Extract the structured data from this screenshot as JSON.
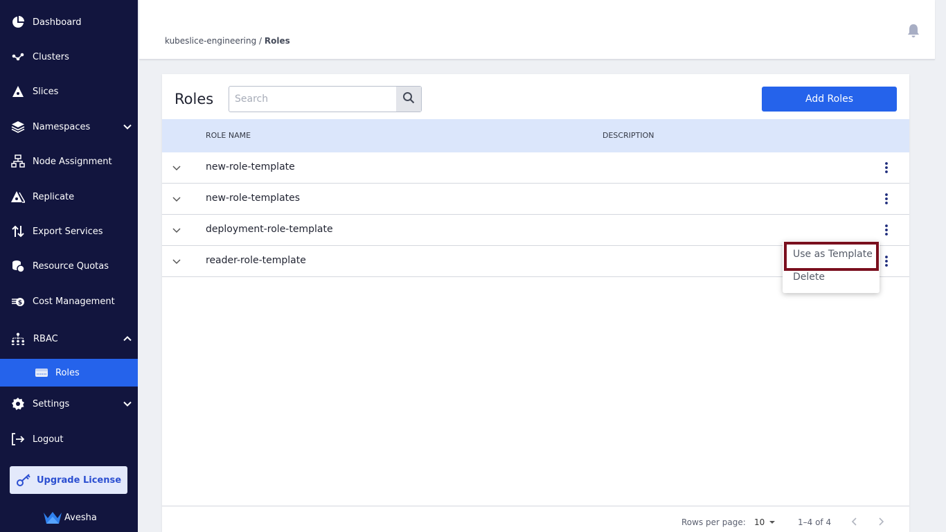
{
  "sidebar": {
    "items": [
      {
        "label": "Dashboard",
        "icon": "pie-chart-icon"
      },
      {
        "label": "Clusters",
        "icon": "network-icon"
      },
      {
        "label": "Slices",
        "icon": "slice-icon"
      },
      {
        "label": "Namespaces",
        "icon": "layers-icon"
      },
      {
        "label": "Node Assignment",
        "icon": "sitemap-icon"
      },
      {
        "label": "Replicate",
        "icon": "replicate-icon"
      },
      {
        "label": "Export Services",
        "icon": "arrows-updown-icon"
      },
      {
        "label": "Resource Quotas",
        "icon": "coins-icon"
      },
      {
        "label": "Cost Management",
        "icon": "cost-icon"
      },
      {
        "label": "RBAC",
        "icon": "rbac-icon"
      },
      {
        "label": "Roles",
        "icon": "roles-icon"
      },
      {
        "label": "Settings",
        "icon": "gear-icon"
      },
      {
        "label": "Logout",
        "icon": "logout-icon"
      }
    ],
    "upgrade_label": "Upgrade License",
    "brand": "Avesha"
  },
  "header": {
    "breadcrumb_parent": "kubeslice-engineering",
    "breadcrumb_sep": " / ",
    "breadcrumb_current": "Roles"
  },
  "main": {
    "title": "Roles",
    "search_placeholder": "Search",
    "add_button": "Add Roles",
    "columns": [
      "ROLE NAME",
      "DESCRIPTION"
    ],
    "rows": [
      {
        "name": "new-role-template",
        "description": ""
      },
      {
        "name": "new-role-templates",
        "description": ""
      },
      {
        "name": "deployment-role-template",
        "description": ""
      },
      {
        "name": "reader-role-template",
        "description": ""
      }
    ],
    "pagination": {
      "rows_per_page_label": "Rows per page:",
      "rows_per_page": "10",
      "range": "1–4 of 4"
    }
  },
  "context_menu": {
    "options": [
      "Use as Template",
      "Delete"
    ]
  },
  "colors": {
    "sidebar_bg": "#12153e",
    "accent": "#2563eb",
    "table_header_bg": "#dbe6fb",
    "highlight_border": "#7a0f1e"
  }
}
